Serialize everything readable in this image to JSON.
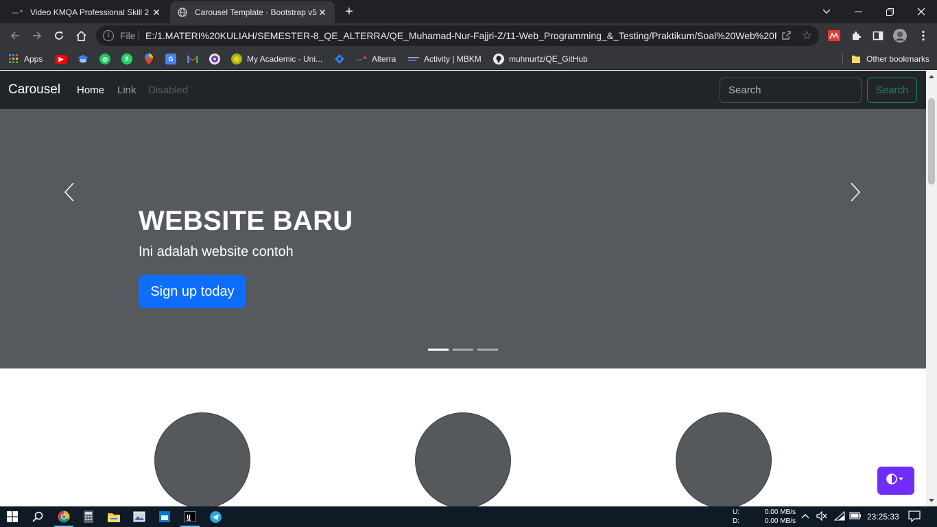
{
  "browser": {
    "tabs": [
      {
        "title": "Video KMQA Professional Skill 2",
        "active": false,
        "icon": "alterra-icon"
      },
      {
        "title": "Carousel Template · Bootstrap v5.",
        "active": true,
        "icon": "globe-icon"
      }
    ],
    "address": {
      "scheme": "File",
      "url": "E:/1.MATERI%20KULIAH/SEMESTER-8_QE_ALTERRA/QE_Muhamad-Nur-Fajjri-Z/11-Web_Programming_&_Testing/Praktikum/Soal%20Web%20Pro..."
    },
    "bookmarks": [
      {
        "label": "Apps",
        "icon": "apps-grid-icon"
      },
      {
        "label": "",
        "icon": "youtube-icon"
      },
      {
        "label": "",
        "icon": "graduation-icon"
      },
      {
        "label": "",
        "icon": "green-circle-icon"
      },
      {
        "label": "",
        "icon": "whatsapp-icon"
      },
      {
        "label": "",
        "icon": "maps-pin-icon"
      },
      {
        "label": "",
        "icon": "translate-icon"
      },
      {
        "label": "",
        "icon": "gmail-icon"
      },
      {
        "label": "",
        "icon": "university-logo-icon"
      },
      {
        "label": "My Academic - Uni...",
        "icon": "academic-icon"
      },
      {
        "label": "",
        "icon": "jira-icon"
      },
      {
        "label": "Alterra",
        "icon": "alterra-icon"
      },
      {
        "label": "Activity | MBKM",
        "icon": "mbkm-icon"
      },
      {
        "label": "muhnurfz/QE_GitHub",
        "icon": "github-icon"
      }
    ],
    "other_bookmarks": "Other bookmarks"
  },
  "page": {
    "navbar": {
      "brand": "Carousel",
      "links": [
        {
          "label": "Home",
          "state": "active"
        },
        {
          "label": "Link",
          "state": "normal"
        },
        {
          "label": "Disabled",
          "state": "disabled"
        }
      ],
      "search_placeholder": "Search",
      "search_button": "Search"
    },
    "carousel": {
      "title": "WEBSITE BARU",
      "text": "Ini adalah website contoh",
      "button": "Sign up today",
      "slides": 3,
      "active_slide": 1
    },
    "featurettes": 3,
    "colors": {
      "navbar": "#212529",
      "carousel_bg": "#565a5e",
      "primary": "#0d6efd",
      "success": "#198754",
      "theme_toggle": "#712cf9"
    }
  },
  "taskbar": {
    "net_up_label": "U:",
    "net_up": "0.00 MB/s",
    "net_down_label": "D:",
    "net_down": "0.00 MB/s",
    "time": "23:25:33"
  }
}
